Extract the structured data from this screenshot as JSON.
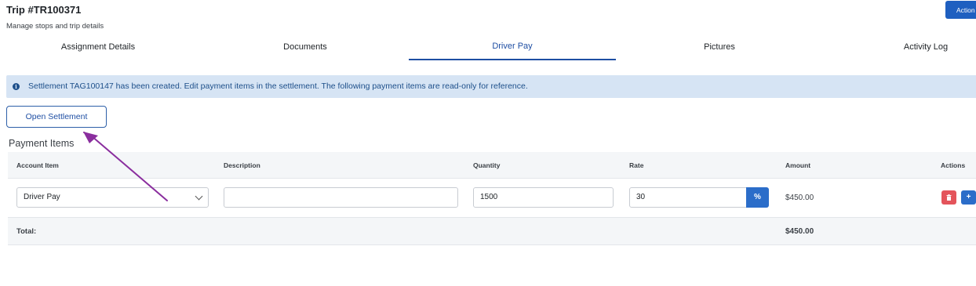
{
  "header": {
    "title": "Trip #TR100371",
    "subtitle": "Manage stops and trip details",
    "action_label": "Action"
  },
  "tabs": [
    {
      "label": "Assignment Details",
      "active": false
    },
    {
      "label": "Documents",
      "active": false
    },
    {
      "label": "Driver Pay",
      "active": true
    },
    {
      "label": "Pictures",
      "active": false
    },
    {
      "label": "Activity Log",
      "active": false
    }
  ],
  "alert": {
    "icon": "info-icon",
    "text": "Settlement TAG100147 has been created. Edit payment items in the settlement. The following payment items are read-only for reference."
  },
  "open_settlement_label": "Open Settlement",
  "section_title": "Payment Items",
  "table": {
    "columns": [
      "Account Item",
      "Description",
      "Quantity",
      "Rate",
      "Amount",
      "Actions"
    ],
    "rows": [
      {
        "account_item": "Driver Pay",
        "description": "",
        "quantity": "1500",
        "rate": "30",
        "rate_unit": "%",
        "amount": "$450.00",
        "actions": {
          "delete_icon": "trash-icon",
          "add_label": "+"
        }
      }
    ],
    "total_label": "Total:",
    "total_value": "$450.00"
  },
  "colors": {
    "accent": "#1e4ea3",
    "primary_button": "#2b6dc9",
    "danger": "#e4545b",
    "alert_bg": "#d6e4f4",
    "annotation_arrow": "#8a2e9e"
  }
}
